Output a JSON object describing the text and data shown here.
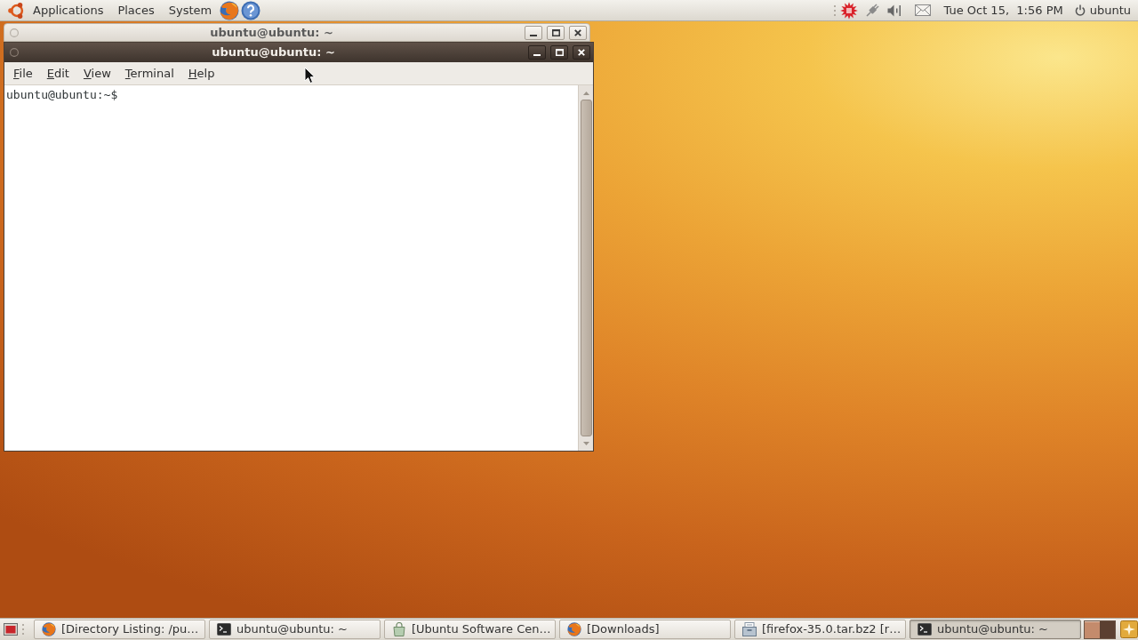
{
  "top_panel": {
    "menus": [
      "Applications",
      "Places",
      "System"
    ],
    "clock": "Tue Oct 15,  1:56 PM",
    "user": "ubuntu"
  },
  "windows": [
    {
      "title": "ubuntu@ubuntu: ~",
      "active": false
    },
    {
      "title": "ubuntu@ubuntu: ~",
      "active": true,
      "menu": [
        "File",
        "Edit",
        "View",
        "Terminal",
        "Help"
      ],
      "terminal_lines": [
        "ubuntu@ubuntu:~$"
      ]
    }
  ],
  "taskbar": {
    "tasks": [
      {
        "label": "[Directory Listing: /pu…",
        "kind": "browser",
        "selected": false
      },
      {
        "label": "ubuntu@ubuntu: ~",
        "kind": "terminal",
        "selected": false
      },
      {
        "label": "[Ubuntu Software Cen…",
        "kind": "software",
        "selected": false
      },
      {
        "label": "[Downloads]",
        "kind": "browser",
        "selected": false
      },
      {
        "label": "[firefox-35.0.tar.bz2 [r…",
        "kind": "archive",
        "selected": false
      },
      {
        "label": "ubuntu@ubuntu: ~",
        "kind": "terminal",
        "selected": true
      }
    ],
    "workspaces": [
      {
        "selected": true
      },
      {
        "selected": false
      }
    ]
  }
}
